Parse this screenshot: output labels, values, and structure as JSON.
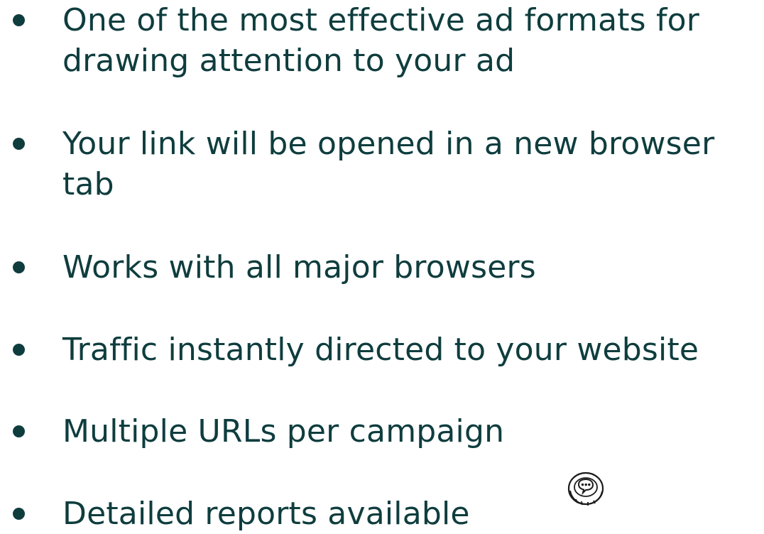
{
  "features": [
    {
      "text": "One of the most effective ad formats for drawing attention to your ad"
    },
    {
      "text": "Your link will be opened in a new browser tab"
    },
    {
      "text": "Works with all major browsers"
    },
    {
      "text": "Traffic instantly directed to your website"
    },
    {
      "text": "Multiple URLs per campaign"
    },
    {
      "text": "Detailed reports available"
    }
  ],
  "colors": {
    "text": "#0f3d3e",
    "background": "#ffffff"
  },
  "icons": {
    "bullet": "bullet-dot-icon",
    "badge": "chat-support-badge-icon"
  }
}
